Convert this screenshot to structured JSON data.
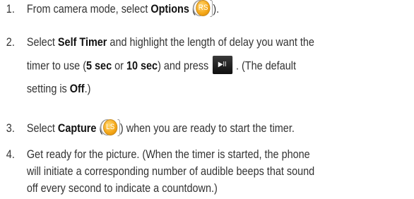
{
  "steps": [
    {
      "number": "1.",
      "pre": "From camera mode, select ",
      "bold": "Options",
      "paren_open": "(",
      "icon_label": "RS",
      "post": ")."
    },
    {
      "number": "2.",
      "pre": "Select ",
      "bold": "Self Timer",
      "mid": " and highlight the length of delay you want the",
      "line2_pre": "timer to use (",
      "opt1": "5 sec",
      "or": " or ",
      "opt2": "10 sec",
      "line2_post": ") and press",
      "icon_label": "▶II",
      "line2_tail": ". (The default",
      "line3_pre": "setting is ",
      "default_value": "Off",
      "line3_post": ".)"
    },
    {
      "number": "3.",
      "pre": "Select ",
      "bold": "Capture",
      "paren_open": "(",
      "icon_label": "LS",
      "post": ") when you are ready to start the timer."
    },
    {
      "number": "4.",
      "line1": "Get ready for the picture. (When the timer is started, the phone",
      "line2": "will initiate a corresponding number of audible beeps that sound",
      "line3": "off every second to indicate a countdown.)"
    }
  ],
  "colors": {
    "text": "#333333",
    "softkey": "#f6a91a",
    "play_key": "#1a1a1a"
  },
  "icons": {
    "rs": "right-softkey-icon",
    "play": "play-pause-key-icon",
    "ls": "left-softkey-icon"
  }
}
